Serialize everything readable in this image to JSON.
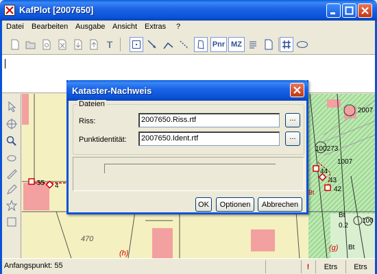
{
  "window": {
    "title": "KafPlot [2007650]"
  },
  "menubar": {
    "items": [
      "Datei",
      "Bearbeiten",
      "Ausgabe",
      "Ansicht",
      "Extras",
      "?"
    ]
  },
  "toolbar": {
    "text_tools": {
      "t_label": "T",
      "pnr_label": "Pnr",
      "mz_label": "MZ"
    }
  },
  "map": {
    "labels": {
      "pt_55": "55",
      "pt_4": "4",
      "num_470": "470",
      "letter_h": "(h)",
      "pt_2007": "2007",
      "pt_100273": "100273",
      "pt_1007": "1007",
      "pt_44": "44",
      "pt_43": "43",
      "pt_42": "42",
      "bt1": "Bt",
      "bt2": "Bt",
      "bt3": "Bt",
      "val_02": "0.2",
      "pt_100": "100",
      "letter_g": "(g)"
    }
  },
  "statusbar": {
    "text": "Anfangspunkt: 55",
    "warning": "!",
    "panel1": "Etrs",
    "panel2": "Etrs"
  },
  "dialog": {
    "title": "Kataster-Nachweis",
    "group_label": "Dateien",
    "riss_label": "Riss:",
    "riss_value": "2007650.Riss.rtf",
    "ident_label": "Punktidentität:",
    "ident_value": "2007650.Ident.rtf",
    "browse_label": "...",
    "progress": 0,
    "ok_label": "OK",
    "options_label": "Optionen",
    "cancel_label": "Abbrechen"
  },
  "colors": {
    "titlebar": "#0a52d6",
    "map_background": "#f5f0bf",
    "building_red": "#f2a0a0",
    "grass_green": "#a8e0a0",
    "survey_red": "#d00000"
  }
}
